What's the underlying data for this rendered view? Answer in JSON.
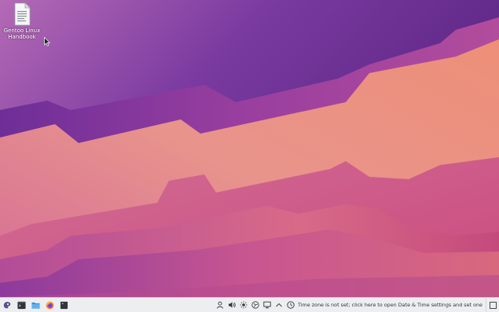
{
  "desktop": {
    "icons": [
      {
        "label_line1": "Gentoo Linux",
        "label_line2": "Handbook",
        "icon": "text-document-icon"
      }
    ]
  },
  "taskbar": {
    "launchers": [
      {
        "name": "application-launcher",
        "icon": "gentoo-logo-icon"
      },
      {
        "name": "terminal",
        "icon": "terminal-icon"
      },
      {
        "name": "file-manager",
        "icon": "folder-icon"
      },
      {
        "name": "firefox",
        "icon": "firefox-icon"
      },
      {
        "name": "konsole",
        "icon": "console-icon"
      }
    ],
    "tray": {
      "icons": [
        "user-icon",
        "volume-icon",
        "brightness-icon",
        "network-icon",
        "display-icon",
        "expand-arrow-icon",
        "clock-icon"
      ],
      "clock_message": "Time zone is not set; click here to open Date & Time settings and set one"
    }
  },
  "colors": {
    "panel_bg": "#eceef0",
    "wallpaper_top": "#5b2a8c",
    "wallpaper_mid": "#c8569a",
    "wallpaper_warm": "#e99a8a"
  }
}
